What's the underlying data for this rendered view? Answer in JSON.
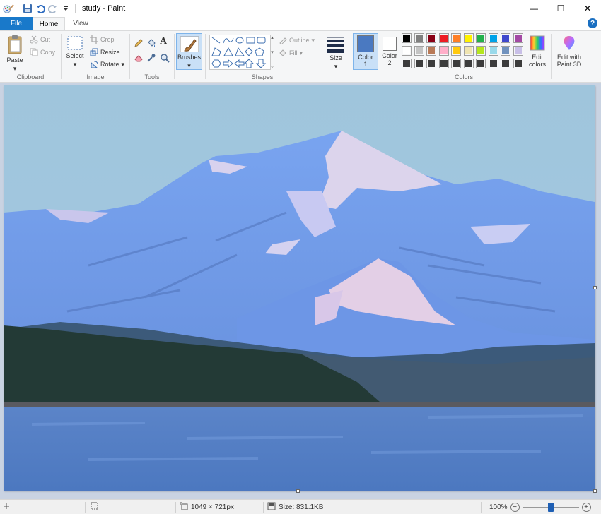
{
  "window": {
    "title": "study - Paint"
  },
  "window_controls": {
    "minimize": "—",
    "maximize": "☐",
    "close": "✕"
  },
  "tabs": [
    {
      "label": "File"
    },
    {
      "label": "Home"
    },
    {
      "label": "View"
    }
  ],
  "help": "?",
  "ribbon": {
    "clipboard": {
      "paste": "Paste",
      "cut": "Cut",
      "copy": "Copy",
      "group": "Clipboard"
    },
    "image": {
      "select": "Select",
      "crop": "Crop",
      "resize": "Resize",
      "rotate": "Rotate",
      "group": "Image"
    },
    "tools": {
      "group": "Tools",
      "text_icon": "A"
    },
    "brushes": {
      "label": "Brushes"
    },
    "shapes": {
      "outline": "Outline",
      "fill": "Fill",
      "group": "Shapes"
    },
    "size": {
      "label": "Size"
    },
    "color1": {
      "label": "Color",
      "num": "1",
      "value": "#4a79c1"
    },
    "color2": {
      "label": "Color",
      "num": "2",
      "value": "#ffffff"
    },
    "colors": {
      "group": "Colors",
      "row1": [
        "#000000",
        "#7f7f7f",
        "#880015",
        "#ed1c24",
        "#ff7f27",
        "#fff200",
        "#22b14c",
        "#00a2e8",
        "#3f48cc",
        "#a349a4"
      ],
      "row2": [
        "#ffffff",
        "#c3c3c3",
        "#b97a57",
        "#ffaec9",
        "#ffc90e",
        "#efe4b0",
        "#b5e61d",
        "#99d9ea",
        "#7092be",
        "#c8bfe7"
      ],
      "row3": [
        "#3c3c3c",
        "#3c3c3c",
        "#3c3c3c",
        "#3c3c3c",
        "#3c3c3c",
        "#3c3c3c",
        "#3c3c3c",
        "#3c3c3c",
        "#3c3c3c",
        "#3c3c3c"
      ]
    },
    "edit_colors": {
      "line1": "Edit",
      "line2": "colors"
    },
    "paint3d": {
      "line1": "Edit with",
      "line2": "Paint 3D"
    }
  },
  "statusbar": {
    "dimensions": "1049 × 721px",
    "size": "Size: 831.1KB",
    "zoom": "100%",
    "zoom_minus": "−",
    "zoom_plus": "+",
    "zoom_level": 0.5
  }
}
